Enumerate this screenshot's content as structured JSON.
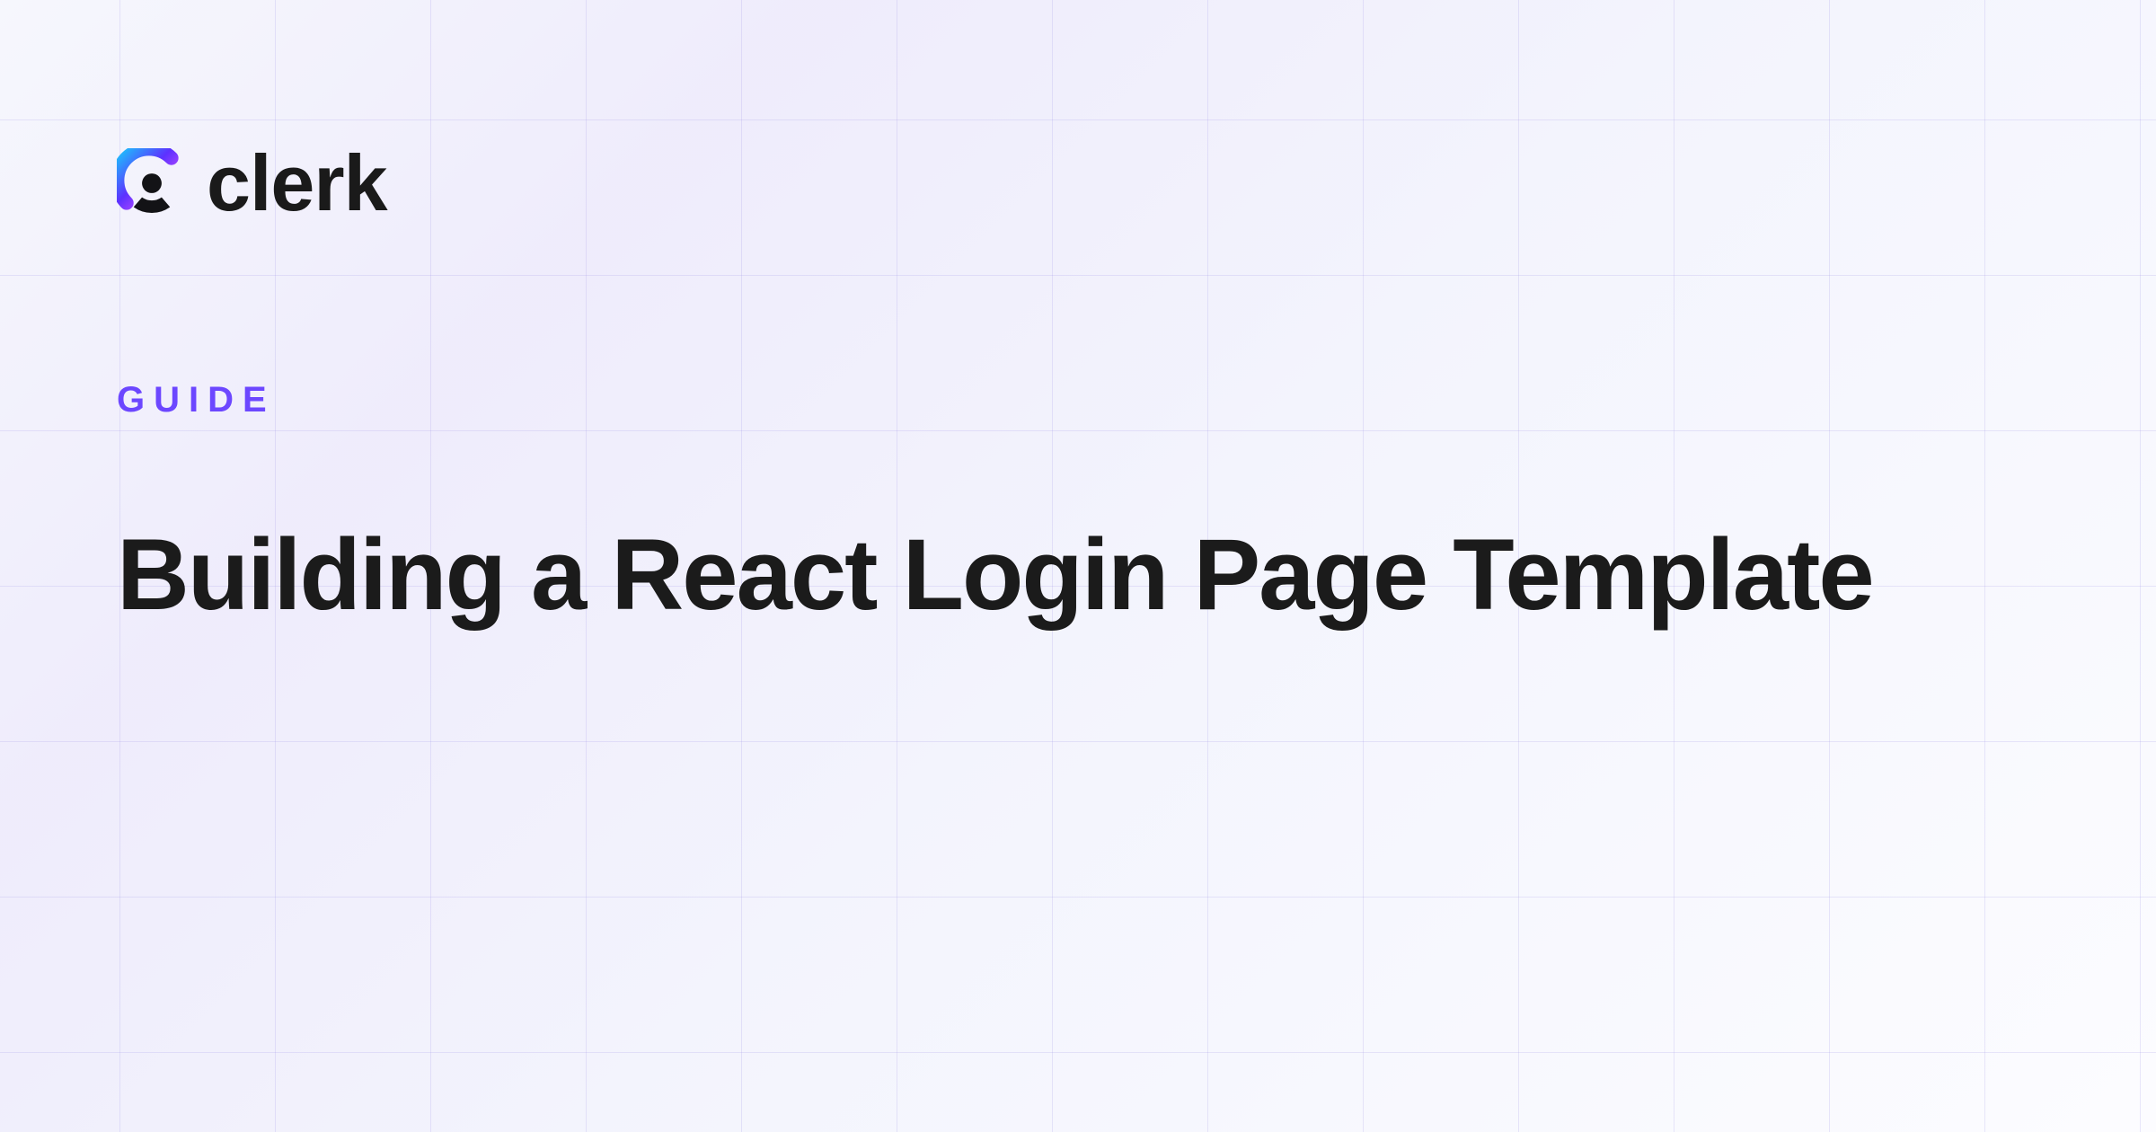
{
  "brand": {
    "name": "clerk",
    "accent_color": "#6C47FF"
  },
  "eyebrow": "GUIDE",
  "title": "Building a React Login Page Template"
}
